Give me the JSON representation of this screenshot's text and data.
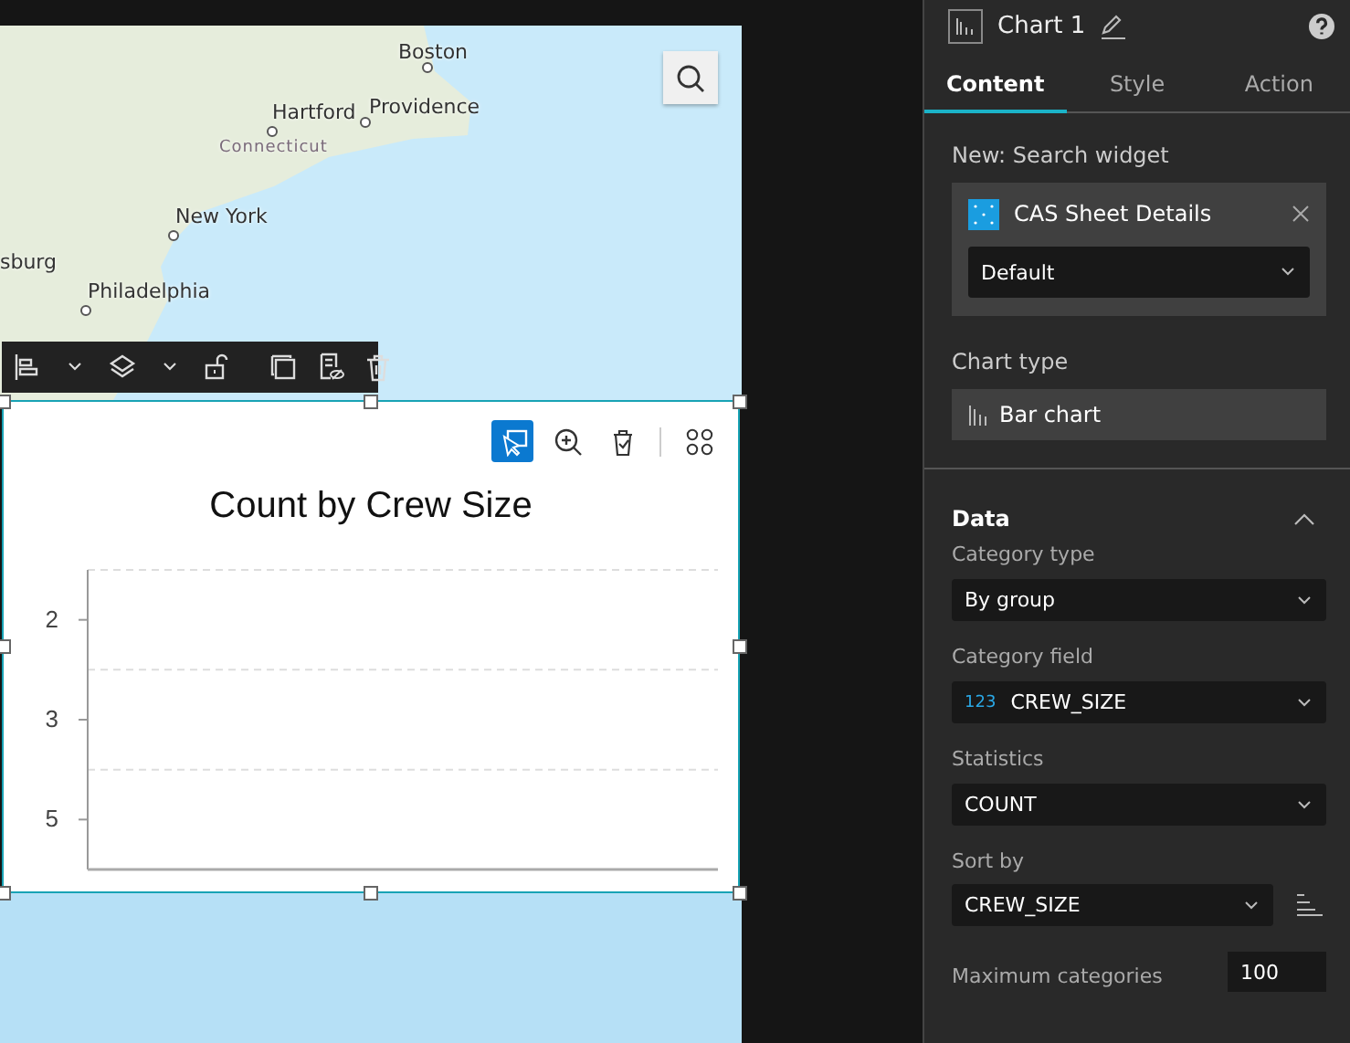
{
  "map": {
    "labels": [
      {
        "text": "Boston",
        "kind": "city"
      },
      {
        "text": "Hartford",
        "kind": "city"
      },
      {
        "text": "Providence",
        "kind": "city"
      },
      {
        "text": "Connecticut",
        "kind": "region"
      },
      {
        "text": "New York",
        "kind": "city"
      },
      {
        "text": "sburg",
        "kind": "city"
      },
      {
        "text": "Philadelphia",
        "kind": "city"
      }
    ]
  },
  "chart_widget": {
    "tools": [
      {
        "kind": "select",
        "selected": true
      },
      {
        "kind": "zoom",
        "selected": false
      },
      {
        "kind": "clear",
        "selected": false
      },
      {
        "kind": "layout",
        "selected": false
      }
    ],
    "chart": {
      "title": "Count by Crew Size",
      "axis_labels": [
        "2",
        "3",
        "5"
      ]
    }
  },
  "panel": {
    "title": "Chart 1",
    "tabs": [
      {
        "label": "Content",
        "selected": true
      },
      {
        "label": "Style",
        "selected": false
      },
      {
        "label": "Action",
        "selected": false
      }
    ],
    "data_source_label": "New: Search widget",
    "data_source": {
      "name": "CAS Sheet Details",
      "view": "Default"
    },
    "chart_type_label": "Chart type",
    "chart_type": "Bar chart",
    "data_section": {
      "title": "Data",
      "expanded": true,
      "fields": [
        {
          "label": "Category type",
          "value": "By group",
          "kind": "select"
        },
        {
          "label": "Category field",
          "value": "CREW_SIZE",
          "kind": "select",
          "field_type": "123"
        },
        {
          "label": "Statistics",
          "value": "COUNT",
          "kind": "select"
        },
        {
          "label": "Sort by",
          "value": "CREW_SIZE",
          "kind": "sort"
        },
        {
          "label": "Maximum categories",
          "value": "100",
          "kind": "number"
        }
      ]
    }
  }
}
